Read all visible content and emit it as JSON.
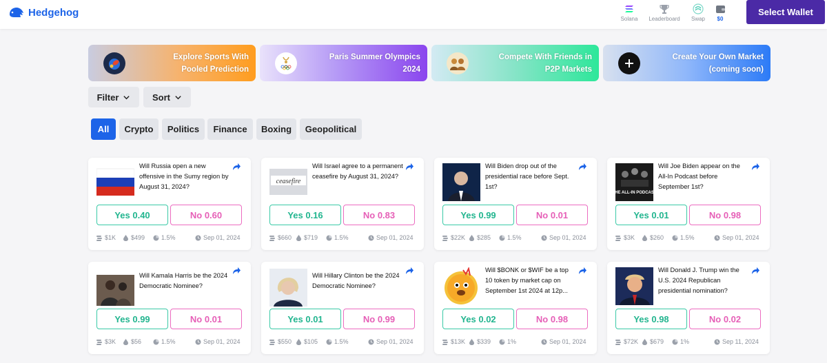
{
  "brand": {
    "name": "Hedgehog"
  },
  "nav": {
    "solana": "Solana",
    "leaderboard": "Leaderboard",
    "swap": "Swap",
    "balance": "$0",
    "select_wallet": "Select Wallet"
  },
  "banners": [
    {
      "line1": "Explore Sports With",
      "line2": "Pooled Prediction",
      "icon": "sports-ball-icon"
    },
    {
      "line1": "Paris Summer Olympics",
      "line2": "2024",
      "icon": "olympics-logo-icon"
    },
    {
      "line1": "Compete With Friends in",
      "line2": "P2P Markets",
      "icon": "friends-icon"
    },
    {
      "line1": "Create Your Own Market",
      "line2": "(coming soon)",
      "icon": "plus-icon"
    }
  ],
  "filter_label": "Filter",
  "sort_label": "Sort",
  "categories": [
    "All",
    "Crypto",
    "Politics",
    "Finance",
    "Boxing",
    "Geopolitical"
  ],
  "active_category": "All",
  "colors": {
    "primary": "#1d64e8",
    "wallet_button": "#4b2aa6",
    "yes": "#22b58f",
    "no": "#e65fb7"
  },
  "markets": [
    {
      "question": "Will Russia open a new offensive in the Sumy region by August 31, 2024?",
      "yes": "Yes 0.40",
      "no": "No 0.60",
      "volume": "$1K",
      "liquidity": "$499",
      "fee": "1.5%",
      "date": "Sep 01, 2024",
      "image": "russia-flag"
    },
    {
      "question": "Will Israel agree to a permanent ceasefire by August 31, 2024?",
      "yes": "Yes 0.16",
      "no": "No 0.83",
      "volume": "$660",
      "liquidity": "$719",
      "fee": "1.5%",
      "date": "Sep 01, 2024",
      "image": "ceasefire",
      "image_text": "ceasefire"
    },
    {
      "question": "Will Biden drop out of the presidential race before Sept. 1st?",
      "yes": "Yes 0.99",
      "no": "No 0.01",
      "volume": "$22K",
      "liquidity": "$285",
      "fee": "1.5%",
      "date": "Sep 01, 2024",
      "image": "biden-photo"
    },
    {
      "question": "Will Joe Biden appear on the All-In Podcast before September 1st?",
      "yes": "Yes 0.01",
      "no": "No 0.98",
      "volume": "$3K",
      "liquidity": "$260",
      "fee": "1.5%",
      "date": "Sep 01, 2024",
      "image": "all-in-podcast",
      "image_text": "THE ALL-IN PODCAST"
    },
    {
      "question": "Will Kamala Harris be the 2024 Democratic Nominee?",
      "yes": "Yes 0.99",
      "no": "No 0.01",
      "volume": "$3K",
      "liquidity": "$56",
      "fee": "1.5%",
      "date": "Sep 01, 2024",
      "image": "harris-photo"
    },
    {
      "question": "Will Hillary Clinton be the 2024 Democratic Nominee?",
      "yes": "Yes 0.01",
      "no": "No 0.99",
      "volume": "$550",
      "liquidity": "$105",
      "fee": "1.5%",
      "date": "Sep 01, 2024",
      "image": "clinton-photo"
    },
    {
      "question": "Will $BONK or $WIF be a top 10 token by market cap on September 1st 2024 at 12p...",
      "yes": "Yes 0.02",
      "no": "No 0.98",
      "volume": "$13K",
      "liquidity": "$339",
      "fee": "1%",
      "date": "Sep 01, 2024",
      "image": "bonk-dog"
    },
    {
      "question": "Will Donald J. Trump win the U.S. 2024 Republican presidential nomination?",
      "yes": "Yes 0.98",
      "no": "No 0.02",
      "volume": "$72K",
      "liquidity": "$679",
      "fee": "1%",
      "date": "Sep 11, 2024",
      "image": "trump-photo"
    }
  ]
}
